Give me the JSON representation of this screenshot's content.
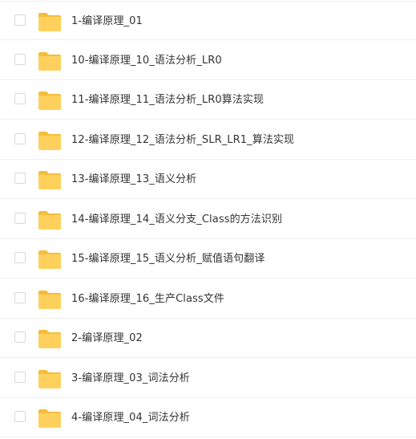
{
  "icons": {
    "folder": "folder-icon",
    "checkbox": "checkbox"
  },
  "colors": {
    "folder_fill": "#ffd15c",
    "folder_tab": "#f5bd3b",
    "row_border": "#f0f0f0",
    "text": "#333333"
  },
  "files": [
    {
      "name": "1-编译原理_01"
    },
    {
      "name": "10-编译原理_10_语法分析_LR0"
    },
    {
      "name": "11-编译原理_11_语法分析_LR0算法实现"
    },
    {
      "name": "12-编译原理_12_语法分析_SLR_LR1_算法实现"
    },
    {
      "name": "13-编译原理_13_语义分析"
    },
    {
      "name": "14-编译原理_14_语义分支_Class的方法识别"
    },
    {
      "name": "15-编译原理_15_语义分析_赋值语句翻译"
    },
    {
      "name": "16-编译原理_16_生产Class文件"
    },
    {
      "name": "2-编译原理_02"
    },
    {
      "name": "3-编译原理_03_词法分析"
    },
    {
      "name": "4-编译原理_04_词法分析"
    }
  ]
}
